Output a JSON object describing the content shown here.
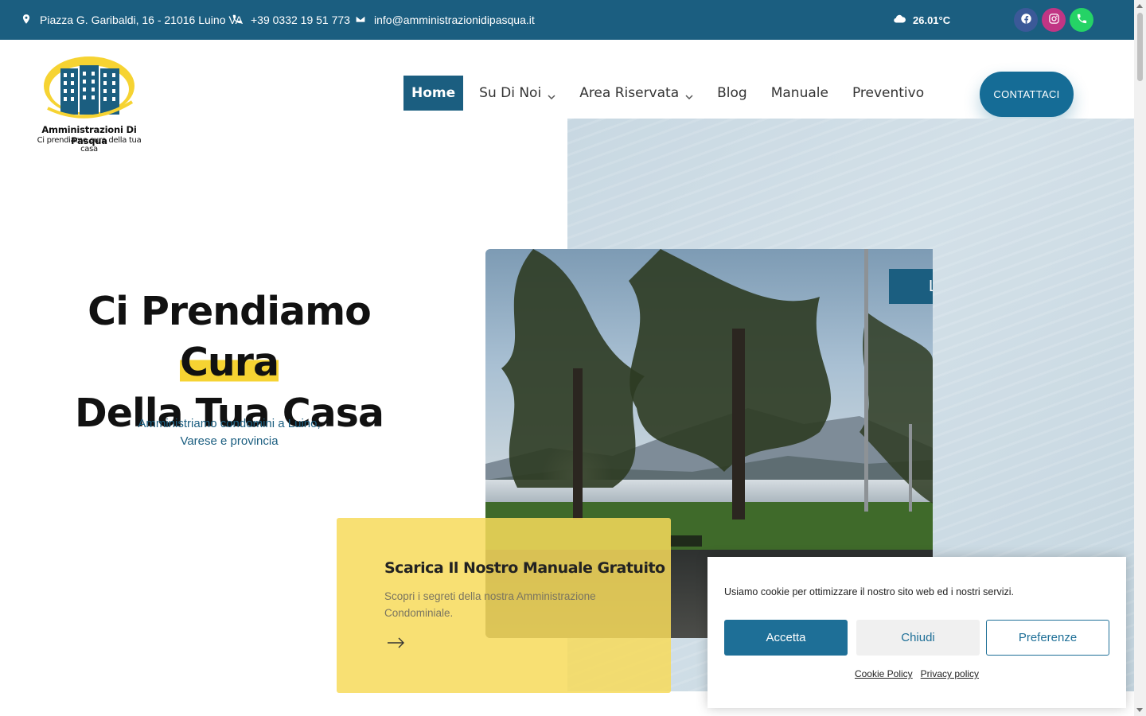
{
  "topbar": {
    "address": "Piazza G. Garibaldi, 16 - 21016 Luino VA",
    "phone": "+39 0332 19 51 773",
    "email": "info@amministrazionidipasqua.it",
    "weather": "26.01°C",
    "colors": {
      "background": "#1b5e80",
      "facebook": "#3b5998",
      "instagram": "#c13584",
      "whatsapp": "#25d366"
    }
  },
  "logo": {
    "name": "Amministrazioni Di Pasqua",
    "tagline": "Ci prendiamo cura della tua casa"
  },
  "nav": {
    "items": [
      {
        "label": "Home",
        "active": true,
        "dropdown": false
      },
      {
        "label": "Su Di Noi",
        "active": false,
        "dropdown": true
      },
      {
        "label": "Area Riservata",
        "active": false,
        "dropdown": true
      },
      {
        "label": "Blog",
        "active": false,
        "dropdown": false
      },
      {
        "label": "Manuale",
        "active": false,
        "dropdown": false
      },
      {
        "label": "Preventivo",
        "active": false,
        "dropdown": false
      }
    ],
    "cta": "CONTATTACI"
  },
  "hero": {
    "title_part1": "Ci Prendiamo ",
    "title_highlight": "Cura",
    "title_line2": "Della Tua Casa",
    "subtitle": "Amministriamo condomini a Luino, Varese e provincia",
    "photo_tab": "L"
  },
  "card": {
    "title": "Scarica Il Nostro Manuale Gratuito",
    "text": "Scopri i segreti della nostra Amministrazione Condominiale."
  },
  "cookie": {
    "message": "Usiamo cookie per ottimizzare il nostro sito web ed i nostri servizi.",
    "accept": "Accetta",
    "close": "Chiudi",
    "preferences": "Preferenze",
    "cookie_policy": "Cookie Policy",
    "privacy_policy": "Privacy policy"
  }
}
